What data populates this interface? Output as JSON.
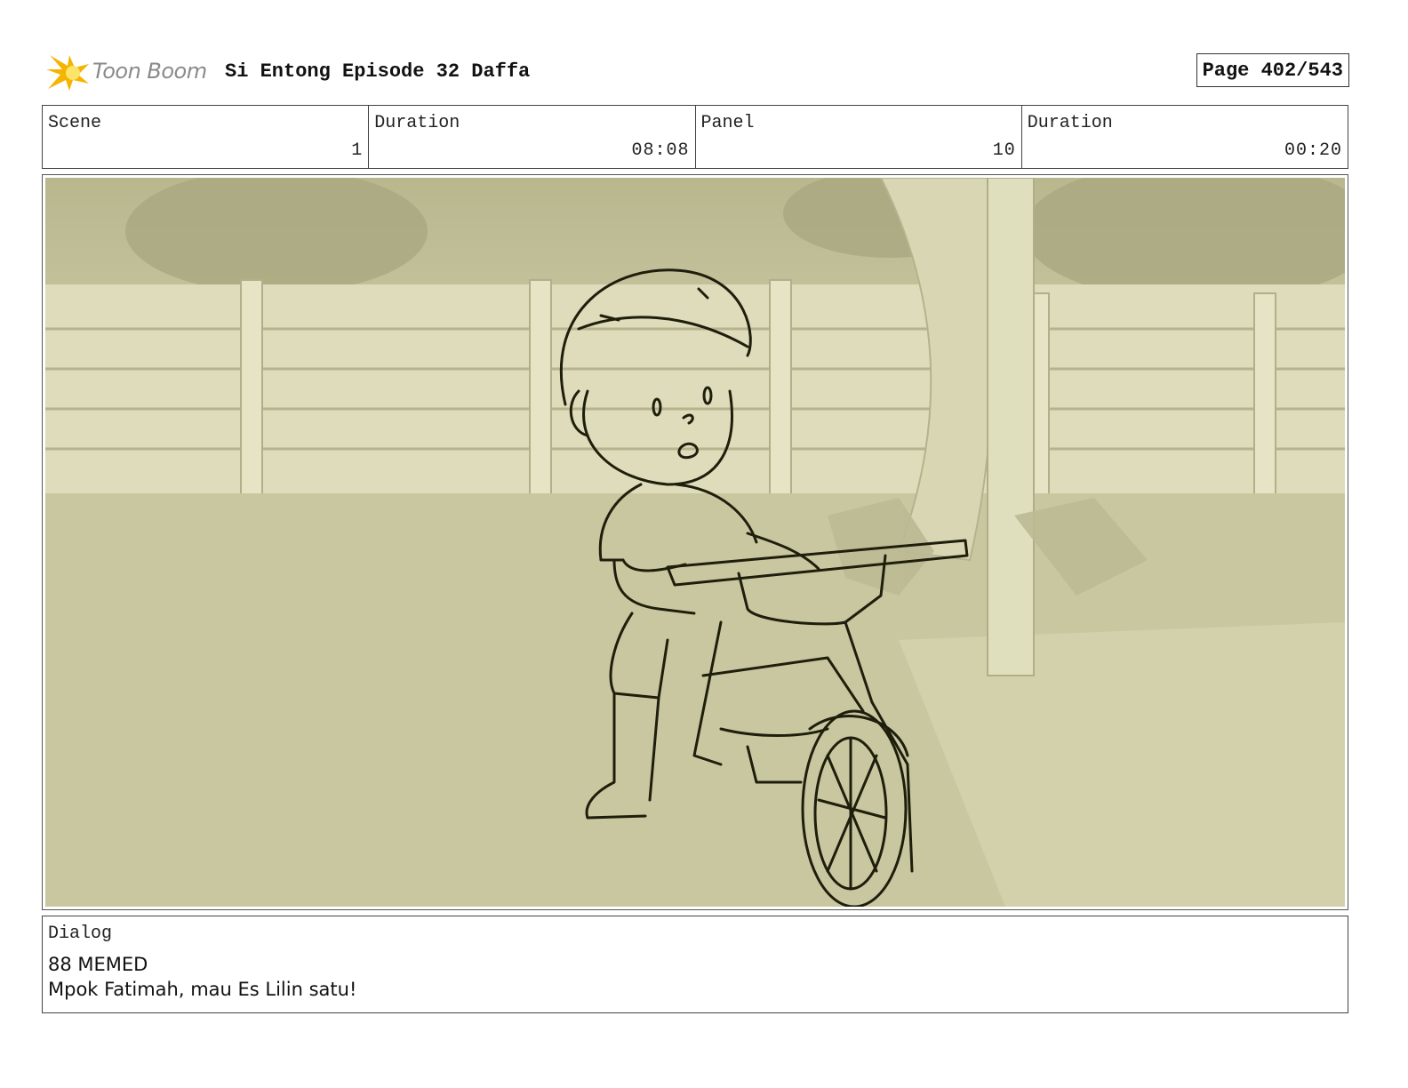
{
  "header": {
    "logo_text": "Toon Boom",
    "project_title": "Si Entong Episode 32 Daffa",
    "page_number": "Page 402/543"
  },
  "info": {
    "scene_label": "Scene",
    "scene_value": "1",
    "scene_duration_label": "Duration",
    "scene_duration_value": "08:08",
    "panel_label": "Panel",
    "panel_value": "10",
    "panel_duration_label": "Duration",
    "panel_duration_value": "00:20"
  },
  "colors": {
    "panel_tint": "#c9c7a0",
    "sketch_line": "#1e1e0c",
    "logo_accent": "#f2b705"
  },
  "dialog": {
    "label": "Dialog",
    "line1": "88 MEMED",
    "line2": "Mpok Fatimah, mau Es Lilin satu!"
  }
}
